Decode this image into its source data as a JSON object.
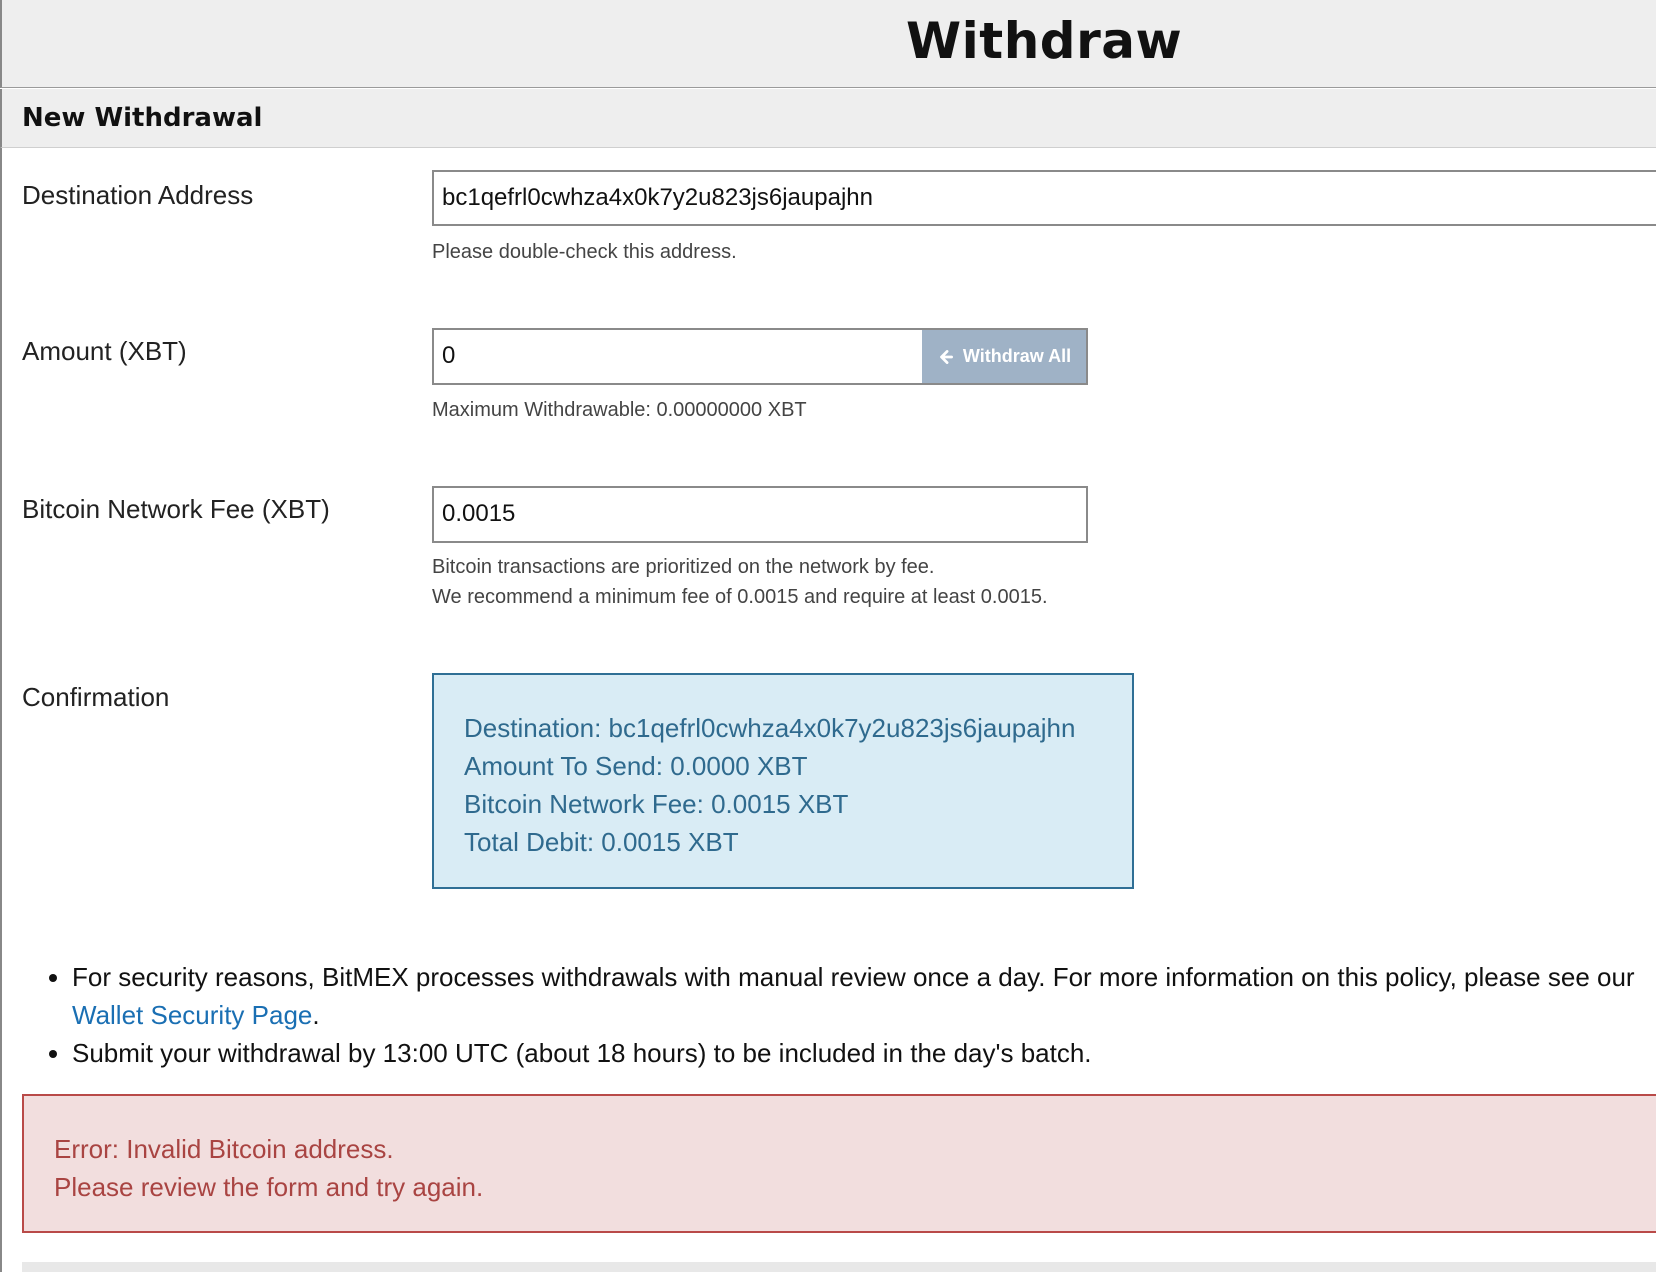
{
  "page": {
    "title": "Withdraw",
    "section_header": "New Withdrawal"
  },
  "form": {
    "destination": {
      "label": "Destination Address",
      "value": "bc1qefrl0cwhza4x0k7y2u823js6jaupajhn",
      "help": "Please double-check this address."
    },
    "amount": {
      "label": "Amount (XBT)",
      "value": "0",
      "withdraw_all_label": "Withdraw All",
      "help": "Maximum Withdrawable: 0.00000000 XBT"
    },
    "fee": {
      "label": "Bitcoin Network Fee (XBT)",
      "value": "0.0015",
      "help_line1": "Bitcoin transactions are prioritized on the network by fee.",
      "help_line2": "We recommend a minimum fee of 0.0015 and require at least 0.0015."
    },
    "confirmation": {
      "label": "Confirmation",
      "destination": "Destination: bc1qefrl0cwhza4x0k7y2u823js6jaupajhn",
      "amount": "Amount To Send: 0.0000 XBT",
      "fee": "Bitcoin Network Fee: 0.0015 XBT",
      "total": "Total Debit: 0.0015 XBT"
    }
  },
  "notes": {
    "bullet1_text": "For security reasons, BitMEX processes withdrawals with manual review once a day. For more information on this policy, please see our ",
    "bullet1_link": "Wallet Security Page",
    "bullet1_end": ".",
    "bullet2": "Submit your withdrawal by 13:00 UTC (about 18 hours) to be included in the day's batch."
  },
  "error": {
    "line1": "Error: Invalid Bitcoin address.",
    "line2": "Please review the form and try again."
  },
  "icons": {
    "withdraw_all": "arrow-left-icon"
  },
  "colors": {
    "confirm_bg": "#d9ecf5",
    "confirm_text": "#2f6a8e",
    "error_bg": "#f2dede",
    "error_text": "#a94442",
    "link": "#1a6fb3",
    "withdraw_all_bg": "#9fb2c6"
  }
}
